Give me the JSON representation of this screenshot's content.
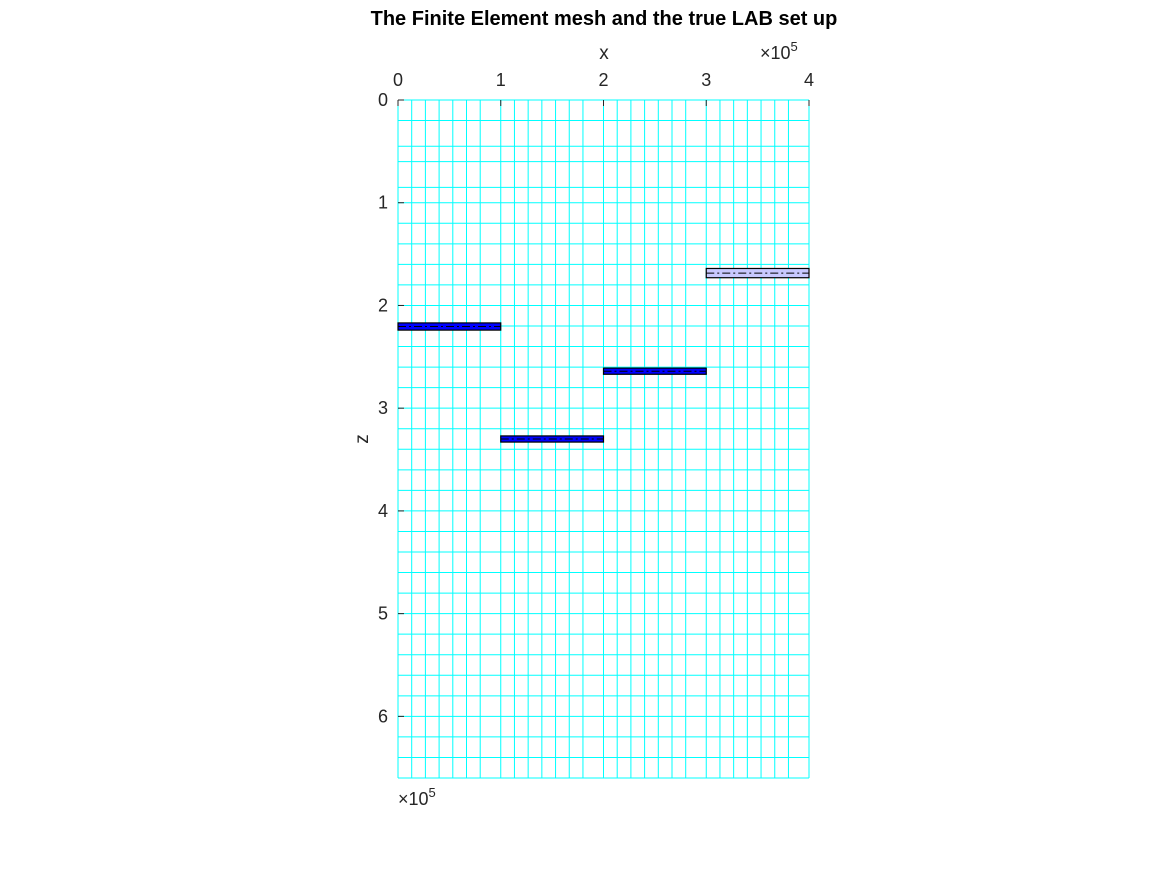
{
  "chart_data": {
    "type": "mesh_with_blocks",
    "title": "The Finite Element mesh and the true LAB set up",
    "xlabel": "x",
    "ylabel": "z",
    "x_axis_location": "top",
    "y_axis_direction": "reversed",
    "x_exponent_label": "×10",
    "x_exponent_power": "5",
    "z_exponent_label": "×10",
    "z_exponent_power": "5",
    "xlim": [
      0,
      400000
    ],
    "zlim": [
      0,
      660000
    ],
    "x_ticks": [
      0,
      100000,
      200000,
      300000,
      400000
    ],
    "x_tick_labels": [
      "0",
      "1",
      "2",
      "3",
      "4"
    ],
    "z_ticks": [
      0,
      100000,
      200000,
      300000,
      400000,
      500000,
      600000
    ],
    "z_tick_labels": [
      "0",
      "1",
      "2",
      "3",
      "4",
      "5",
      "6"
    ],
    "mesh": {
      "x_lines": [
        0,
        13333,
        26667,
        40000,
        53333,
        66667,
        80000,
        100000,
        113333,
        126667,
        140000,
        153333,
        166667,
        180000,
        200000,
        213333,
        226667,
        240000,
        253333,
        266667,
        280000,
        300000,
        313333,
        326667,
        340000,
        353333,
        366667,
        380000,
        400000
      ],
      "z_lines": [
        0,
        20000,
        45000,
        60000,
        85000,
        100000,
        120000,
        140000,
        160000,
        180000,
        200000,
        220000,
        240000,
        260000,
        280000,
        300000,
        320000,
        340000,
        360000,
        380000,
        400000,
        420000,
        440000,
        460000,
        480000,
        500000,
        520000,
        540000,
        560000,
        580000,
        600000,
        620000,
        640000,
        660000
      ],
      "color": "#00ffff"
    },
    "lab_blocks": [
      {
        "x0": 0,
        "x1": 100000,
        "z_top": 217000,
        "z_bottom": 224000,
        "fill": "#0000ff"
      },
      {
        "x0": 100000,
        "x1": 200000,
        "z_top": 327000,
        "z_bottom": 333000,
        "fill": "#0000ff"
      },
      {
        "x0": 200000,
        "x1": 300000,
        "z_top": 261000,
        "z_bottom": 267000,
        "fill": "#0000ff"
      },
      {
        "x0": 300000,
        "x1": 400000,
        "z_top": 164000,
        "z_bottom": 173000,
        "fill": "#c8c8ff"
      }
    ],
    "block_edge_color": "#000000",
    "grid": false,
    "legend": "none"
  }
}
